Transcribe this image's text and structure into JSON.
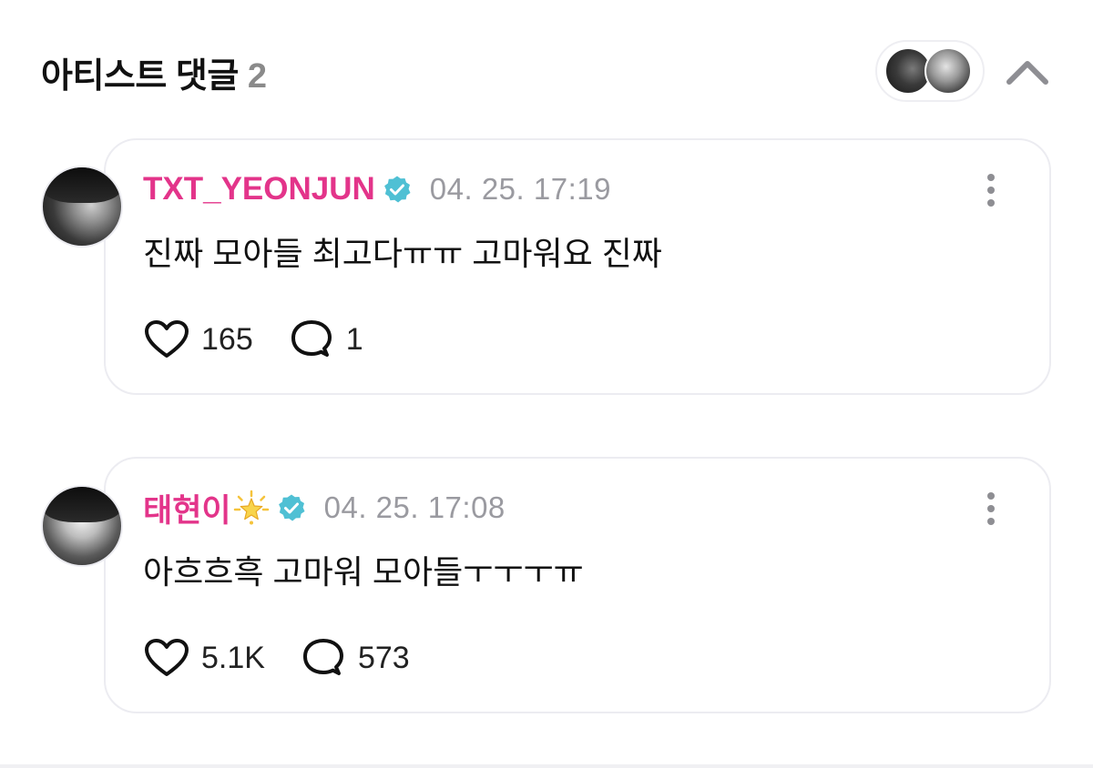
{
  "header": {
    "title": "아티스트 댓글",
    "count": "2",
    "collapse_icon": "chevron-up-icon"
  },
  "comments": [
    {
      "username": "TXT_YEONJUN",
      "badge": "verified-icon",
      "timestamp": "04. 25. 17:19",
      "text": "진짜 모아들 최고다ㅠㅠ 고마워요 진짜",
      "likes": "165",
      "replies": "1"
    },
    {
      "username": "태현이",
      "username_emoji": "star-icon",
      "badge": "verified-icon",
      "timestamp": "04. 25. 17:08",
      "text": "아흐흐흑 고마워 모아들ㅜㅜㅜㅠ",
      "likes": "5.1K",
      "replies": "573"
    }
  ],
  "colors": {
    "username": "#e3348a",
    "verified": "#4fc0d4",
    "timestamp": "#9a9aa0",
    "card_border": "#ececf1",
    "count": "#8a8a8a"
  }
}
